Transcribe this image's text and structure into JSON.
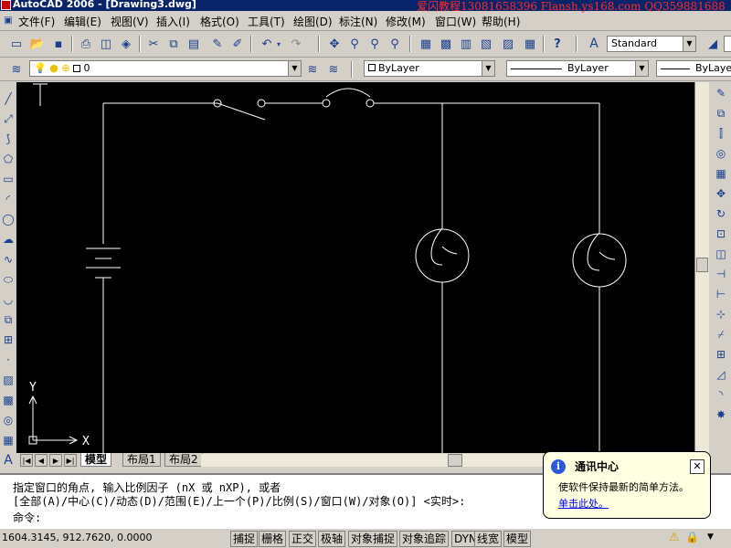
{
  "titlebar": {
    "title": "AutoCAD 2006 - [Drawing3.dwg]"
  },
  "watermark": "爱闪教程13081658396 Flansh.ys168.com QQ359881688",
  "menu": [
    "文件(F)",
    "编辑(E)",
    "视图(V)",
    "插入(I)",
    "格式(O)",
    "工具(T)",
    "绘图(D)",
    "标注(N)",
    "修改(M)",
    "窗口(W)",
    "帮助(H)"
  ],
  "toolbar": {
    "text_style": "Standard",
    "layer": "0",
    "color": "ByLayer",
    "linetype": "ByLayer",
    "lineweight": "ByLayer"
  },
  "drawing": {
    "ucs_y": "Y",
    "ucs_x": "X"
  },
  "layout_tabs": [
    "模型",
    "布局1",
    "布局2"
  ],
  "command": {
    "line1": "指定窗口的角点, 输入比例因子 (nX 或 nXP), 或者",
    "line2": "[全部(A)/中心(C)/动态(D)/范围(E)/上一个(P)/比例(S)/窗口(W)/对象(O)] <实时>:",
    "prompt": "命令:"
  },
  "status": {
    "coords": "1604.3145, 912.7620, 0.0000",
    "buttons": [
      "捕捉",
      "栅格",
      "正交",
      "极轴",
      "对象捕捉",
      "对象追踪",
      "DYN",
      "线宽",
      "模型"
    ]
  },
  "balloon": {
    "title": "通讯中心",
    "info_glyph": "i",
    "close_glyph": "✕",
    "message": "使软件保持最新的简单方法。",
    "link": "单击此处。"
  },
  "colors": {
    "canvas": "#000000",
    "drawing": "#ffffff",
    "titlebar": "#0a246a",
    "watermark": "#ff2a2a"
  }
}
